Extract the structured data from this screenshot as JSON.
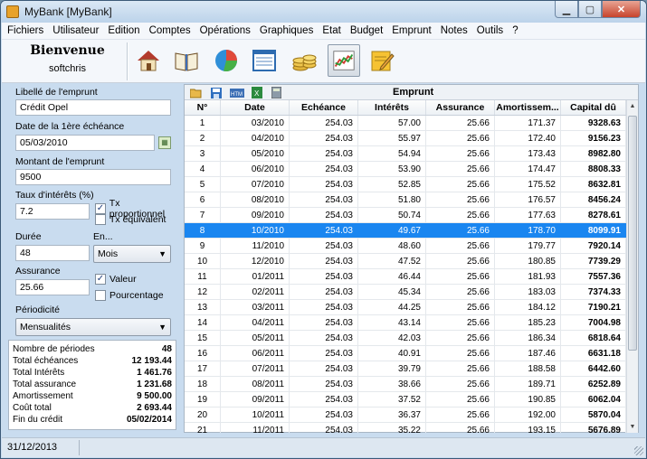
{
  "window": {
    "title": "MyBank [MyBank]"
  },
  "menu": [
    "Fichiers",
    "Utilisateur",
    "Edition",
    "Comptes",
    "Opérations",
    "Graphiques",
    "Etat",
    "Budget",
    "Emprunt",
    "Notes",
    "Outils",
    "?"
  ],
  "welcome": {
    "title": "Bienvenue",
    "user": "softchris"
  },
  "toolbar_icons": [
    "home-icon",
    "book-icon",
    "pie-chart-icon",
    "list-icon",
    "coins-icon",
    "line-chart-icon",
    "edit-icon"
  ],
  "form": {
    "label_libelle": "Libellé de l'emprunt",
    "libelle": "Crédit Opel",
    "label_date": "Date de la 1ère échéance",
    "date": "05/03/2010",
    "label_montant": "Montant de l'emprunt",
    "montant": "9500",
    "label_taux": "Taux d'intérêts (%)",
    "taux": "7.2",
    "chk_proportionnel": "Tx proportionnel",
    "chk_equivalent": "Tx équivalent",
    "label_duree": "Durée",
    "duree": "48",
    "label_en": "En...",
    "unite": "Mois",
    "label_assurance": "Assurance",
    "assurance": "25.66",
    "chk_valeur": "Valeur",
    "chk_pourcentage": "Pourcentage",
    "label_periodicite": "Périodicité",
    "periodicite": "Mensualités"
  },
  "summary": [
    {
      "label": "Nombre de périodes",
      "value": "48"
    },
    {
      "label": "Total échéances",
      "value": "12 193.44"
    },
    {
      "label": "Total Intérêts",
      "value": "1 461.76"
    },
    {
      "label": "Total assurance",
      "value": "1 231.68"
    },
    {
      "label": "Amortissement",
      "value": "9 500.00"
    },
    {
      "label": "Coût total",
      "value": "2 693.44"
    },
    {
      "label": "Fin du crédit",
      "value": "05/02/2014"
    }
  ],
  "panel": {
    "title": "Emprunt"
  },
  "table": {
    "columns": [
      "N°",
      "Date",
      "Echéance",
      "Intérêts",
      "Assurance",
      "Amortissem...",
      "Capital dû"
    ],
    "selected_index": 8,
    "rows": [
      [
        "1",
        "03/2010",
        "254.03",
        "57.00",
        "25.66",
        "171.37",
        "9328.63"
      ],
      [
        "2",
        "04/2010",
        "254.03",
        "55.97",
        "25.66",
        "172.40",
        "9156.23"
      ],
      [
        "3",
        "05/2010",
        "254.03",
        "54.94",
        "25.66",
        "173.43",
        "8982.80"
      ],
      [
        "4",
        "06/2010",
        "254.03",
        "53.90",
        "25.66",
        "174.47",
        "8808.33"
      ],
      [
        "5",
        "07/2010",
        "254.03",
        "52.85",
        "25.66",
        "175.52",
        "8632.81"
      ],
      [
        "6",
        "08/2010",
        "254.03",
        "51.80",
        "25.66",
        "176.57",
        "8456.24"
      ],
      [
        "7",
        "09/2010",
        "254.03",
        "50.74",
        "25.66",
        "177.63",
        "8278.61"
      ],
      [
        "8",
        "10/2010",
        "254.03",
        "49.67",
        "25.66",
        "178.70",
        "8099.91"
      ],
      [
        "9",
        "11/2010",
        "254.03",
        "48.60",
        "25.66",
        "179.77",
        "7920.14"
      ],
      [
        "10",
        "12/2010",
        "254.03",
        "47.52",
        "25.66",
        "180.85",
        "7739.29"
      ],
      [
        "11",
        "01/2011",
        "254.03",
        "46.44",
        "25.66",
        "181.93",
        "7557.36"
      ],
      [
        "12",
        "02/2011",
        "254.03",
        "45.34",
        "25.66",
        "183.03",
        "7374.33"
      ],
      [
        "13",
        "03/2011",
        "254.03",
        "44.25",
        "25.66",
        "184.12",
        "7190.21"
      ],
      [
        "14",
        "04/2011",
        "254.03",
        "43.14",
        "25.66",
        "185.23",
        "7004.98"
      ],
      [
        "15",
        "05/2011",
        "254.03",
        "42.03",
        "25.66",
        "186.34",
        "6818.64"
      ],
      [
        "16",
        "06/2011",
        "254.03",
        "40.91",
        "25.66",
        "187.46",
        "6631.18"
      ],
      [
        "17",
        "07/2011",
        "254.03",
        "39.79",
        "25.66",
        "188.58",
        "6442.60"
      ],
      [
        "18",
        "08/2011",
        "254.03",
        "38.66",
        "25.66",
        "189.71",
        "6252.89"
      ],
      [
        "19",
        "09/2011",
        "254.03",
        "37.52",
        "25.66",
        "190.85",
        "6062.04"
      ],
      [
        "20",
        "10/2011",
        "254.03",
        "36.37",
        "25.66",
        "192.00",
        "5870.04"
      ],
      [
        "21",
        "11/2011",
        "254.03",
        "35.22",
        "25.66",
        "193.15",
        "5676.89"
      ]
    ]
  },
  "status": {
    "date": "31/12/2013"
  }
}
